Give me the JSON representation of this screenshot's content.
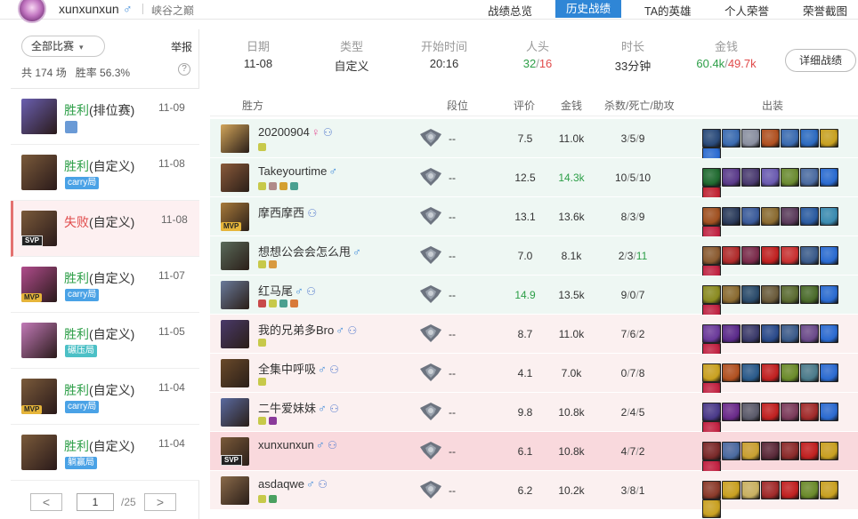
{
  "header": {
    "username": "xunxunxun",
    "gender_symbol": "♂",
    "server": "峡谷之巅",
    "tabs": [
      "战绩总览",
      "历史战绩",
      "TA的英雄",
      "个人荣誉",
      "荣誉截图"
    ],
    "active_tab": "历史战绩",
    "accent": "#2f86d6"
  },
  "sidebar": {
    "filter_label": "全部比赛",
    "report_label": "举报",
    "stats_text": "共 174 场   胜率 56.3%",
    "help_glyph": "?",
    "matches": [
      {
        "result": "胜利",
        "type": "(排位赛)",
        "date": "11-09",
        "tag": "",
        "badge": "",
        "win": true,
        "hero_color": "#6a5fb0"
      },
      {
        "result": "胜利",
        "type": "(自定义)",
        "date": "11-08",
        "tag": "carry局",
        "badge": "",
        "win": true,
        "hero_color": "#7a5a3a"
      },
      {
        "result": "失败",
        "type": "(自定义)",
        "date": "11-08",
        "tag": "",
        "badge": "SVP",
        "win": false,
        "hero_color": "#7a5a3a"
      },
      {
        "result": "胜利",
        "type": "(自定义)",
        "date": "11-07",
        "tag": "carry局",
        "badge": "MVP",
        "win": true,
        "hero_color": "#b04c8c"
      },
      {
        "result": "胜利",
        "type": "(自定义)",
        "date": "11-05",
        "tag": "碾压局",
        "badge": "",
        "win": true,
        "hero_color": "#c27ab8"
      },
      {
        "result": "胜利",
        "type": "(自定义)",
        "date": "11-04",
        "tag": "carry局",
        "badge": "MVP",
        "win": true,
        "hero_color": "#7a5a3a"
      },
      {
        "result": "胜利",
        "type": "(自定义)",
        "date": "11-04",
        "tag": "躺赢局",
        "badge": "",
        "win": true,
        "hero_color": "#7a5a3a"
      }
    ],
    "pager": {
      "prev": "<",
      "current": "1",
      "total": "/25",
      "next": ">"
    }
  },
  "summary": {
    "date_label": "日期",
    "date": "11-08",
    "type_label": "类型",
    "type": "自定义",
    "start_label": "开始时间",
    "start": "20:16",
    "kills_label": "人头",
    "kills_a": "32",
    "kills_sep": "/",
    "kills_b": "16",
    "duration_label": "时长",
    "duration": "33分钟",
    "gold_label": "金钱",
    "gold_a": "60.4k",
    "gold_sep": "/",
    "gold_b": "49.7k",
    "detail_button": "详细战绩"
  },
  "table": {
    "headers": {
      "team": "胜方",
      "rank": "段位",
      "score": "评价",
      "gold": "金钱",
      "kda": "杀数/死亡/助攻",
      "items": "出装"
    },
    "rows": [
      {
        "name": "20200904",
        "gender": "♀",
        "friend": true,
        "badge": "",
        "rank": "--",
        "score": "7.5",
        "gold": "11.0k",
        "k": "3",
        "d": "5",
        "a": "9",
        "team": "a",
        "hero": "#d2a55a",
        "icons": [
          "#c7c94a"
        ],
        "items": [
          "#2a4a7a",
          "#3a6ab0",
          "#8a8fa0",
          "#b05020",
          "#3a6ab0",
          "#2c6ac0",
          "#c8a020",
          "#2a6ad0"
        ]
      },
      {
        "name": "Takeyourtime",
        "gender": "♂",
        "friend": false,
        "badge": "",
        "rank": "--",
        "score": "12.5",
        "gold": "14.3k",
        "k": "10",
        "d": "5",
        "a": "10",
        "team": "a",
        "hero": "#8a5a3a",
        "icons": [
          "#c7c94a",
          "#b08a8a",
          "#d4a030",
          "#4aa090"
        ],
        "items": [
          "#206a30",
          "#5a3a8a",
          "#4a3a70",
          "#6a5ab0",
          "#6a8a30",
          "#4a6aa0",
          "#2a6ad0",
          "#c02030"
        ],
        "gold_hi": true
      },
      {
        "name": "摩西摩西",
        "gender": "",
        "friend": true,
        "badge": "MVP",
        "rank": "--",
        "score": "13.1",
        "gold": "13.6k",
        "k": "8",
        "d": "3",
        "a": "9",
        "team": "a",
        "hero": "#a87a3a",
        "icons": [],
        "items": [
          "#a05020",
          "#2a3a5a",
          "#3a5a9a",
          "#8a6a30",
          "#5a3a5a",
          "#2a5aa0",
          "#3a8ab0",
          "#c02040"
        ]
      },
      {
        "name": "想想公会会怎么甩",
        "gender": "♂",
        "friend": false,
        "badge": "",
        "rank": "--",
        "score": "7.0",
        "gold": "8.1k",
        "k": "2",
        "d": "3",
        "a": "11",
        "team": "a",
        "hero": "#5a6a5a",
        "icons": [
          "#c7c94a",
          "#d89a40"
        ],
        "items": [
          "#8a5a30",
          "#b02a2a",
          "#7a2a4a",
          "#c02020",
          "#c83030",
          "#3a5a8a",
          "#2a6ad0",
          "#c02040"
        ],
        "assist_hi": true
      },
      {
        "name": "红马尾",
        "gender": "♂",
        "friend": true,
        "badge": "",
        "rank": "--",
        "score": "14.9",
        "gold": "13.5k",
        "k": "9",
        "d": "0",
        "a": "7",
        "team": "a",
        "hero": "#6a7a9a",
        "icons": [
          "#c84a4a",
          "#c7c94a",
          "#4aa090",
          "#d87a3a"
        ],
        "items": [
          "#8a8a20",
          "#8a6a30",
          "#2a4a6a",
          "#6a5a3a",
          "#5a6a30",
          "#4a6a2a",
          "#2a6ad0",
          "#c02040"
        ],
        "score_hi": true
      },
      {
        "name": "我的兄弟多Bro",
        "gender": "♂",
        "friend": true,
        "badge": "",
        "rank": "--",
        "score": "8.7",
        "gold": "11.0k",
        "k": "7",
        "d": "6",
        "a": "2",
        "team": "b",
        "hero": "#4a3a6a",
        "icons": [
          "#c7c94a"
        ],
        "items": [
          "#6a3a9a",
          "#5a2a8a",
          "#3a3a6a",
          "#2a4a8a",
          "#3a5a8a",
          "#6a4a8a",
          "#2a6ad0",
          "#c02040"
        ]
      },
      {
        "name": "全集中呼吸",
        "gender": "♂",
        "friend": true,
        "badge": "",
        "rank": "--",
        "score": "4.1",
        "gold": "7.0k",
        "k": "0",
        "d": "7",
        "a": "8",
        "team": "b",
        "hero": "#6a4a2a",
        "icons": [
          "#c7c94a"
        ],
        "items": [
          "#c8a020",
          "#b05020",
          "#2a5a8a",
          "#c02020",
          "#6a8a2a",
          "#4a7a8a",
          "#2a6ad0",
          "#c02040"
        ]
      },
      {
        "name": "二牛爱妹妹",
        "gender": "♂",
        "friend": true,
        "badge": "",
        "rank": "--",
        "score": "9.8",
        "gold": "10.8k",
        "k": "2",
        "d": "4",
        "a": "5",
        "team": "b",
        "hero": "#5a6aa0",
        "icons": [
          "#c7c94a",
          "#8a3a9a"
        ],
        "items": [
          "#4a3a8a",
          "#6a2a8a",
          "#5a5a6a",
          "#c02020",
          "#7a3a5a",
          "#a02a2a",
          "#2a6ad0",
          "#c02040"
        ]
      },
      {
        "name": "xunxunxun",
        "gender": "♂",
        "friend": true,
        "badge": "SVP",
        "rank": "--",
        "score": "6.1",
        "gold": "10.8k",
        "k": "4",
        "d": "7",
        "a": "2",
        "team": "self",
        "hero": "#7a5a3a",
        "icons": [],
        "items": [
          "#7a2a2a",
          "#4a6aa0",
          "#c8a030",
          "#5a2a3a",
          "#8a2a2a",
          "#c02020",
          "#c8a020",
          "#c02040"
        ]
      },
      {
        "name": "asdaqwe",
        "gender": "♂",
        "friend": true,
        "badge": "",
        "rank": "--",
        "score": "6.2",
        "gold": "10.2k",
        "k": "3",
        "d": "8",
        "a": "1",
        "team": "b",
        "hero": "#8a6a4a",
        "icons": [
          "#c7c94a",
          "#4aa060"
        ],
        "items": [
          "#8a3a2a",
          "#c8a020",
          "#c8b060",
          "#a02a2a",
          "#c02020",
          "#6a8a2a",
          "#c8a020",
          "#c8a020"
        ]
      }
    ]
  },
  "colors": {
    "win": "#2c9e47",
    "lose": "#e04a4a",
    "male": "#3d8ad9",
    "female": "#e45a9a"
  }
}
